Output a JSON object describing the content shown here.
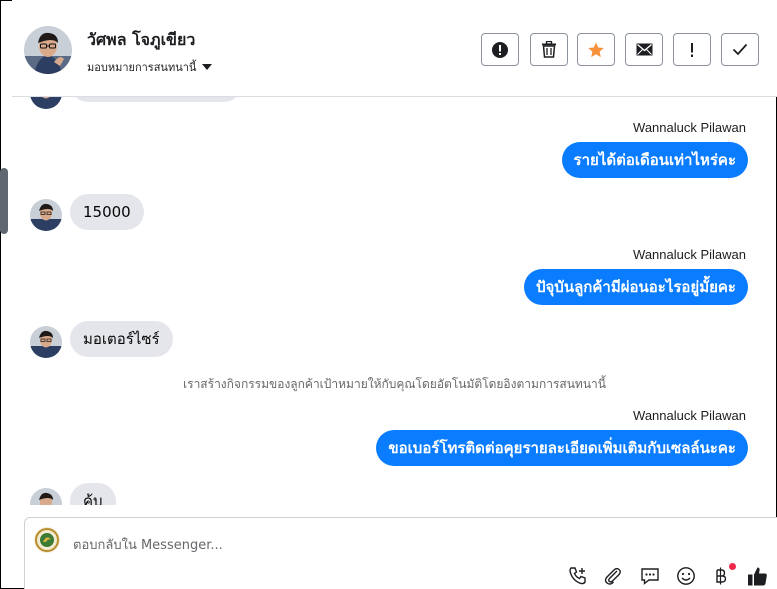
{
  "header": {
    "contact_name": "วัศพล โจภูเขียว",
    "assign_label": "มอบหมายการสนทนานี้",
    "tools": [
      {
        "icon": "alert-circle-icon"
      },
      {
        "icon": "trash-icon"
      },
      {
        "icon": "star-icon"
      },
      {
        "icon": "envelope-icon"
      },
      {
        "icon": "exclamation-icon"
      },
      {
        "icon": "checkmark-icon"
      }
    ],
    "star_color": "#f7923b"
  },
  "conversation": {
    "messages": [
      {
        "direction": "outgoing",
        "sender": "Wannaluck Pilawan",
        "text": "รายได้ต่อเดือนเท่าไหร่คะ"
      },
      {
        "direction": "incoming",
        "text": "15000"
      },
      {
        "direction": "outgoing",
        "sender": "Wannaluck Pilawan",
        "text": "ปัจุบันลูกค้ามีผ่อนอะไรอยู่มั้ยคะ"
      },
      {
        "direction": "incoming",
        "text": "มอเตอร์ไซร์"
      },
      {
        "direction": "system",
        "text": "เราสร้างกิจกรรมของลูกค้าเป้าหมายให้กับคุณโดยอัตโนมัติโดยอิงตามการสนทนานี้"
      },
      {
        "direction": "outgoing",
        "sender": "Wannaluck Pilawan",
        "text": "ขอเบอร์โทรติดต่อคุยรายละเอียดเพิ่มเติมกับเซลล์นะคะ"
      },
      {
        "direction": "incoming",
        "text": "ค้บ"
      }
    ],
    "accent_color": "#0a7cff",
    "incoming_bubble_color": "#e4e6eb"
  },
  "composer": {
    "placeholder": "ตอบกลับใน Messenger...",
    "icons": [
      "phone-add-icon",
      "paperclip-icon",
      "saved-reply-icon",
      "emoji-icon",
      "baht-payment-icon",
      "thumbs-up-icon"
    ]
  }
}
